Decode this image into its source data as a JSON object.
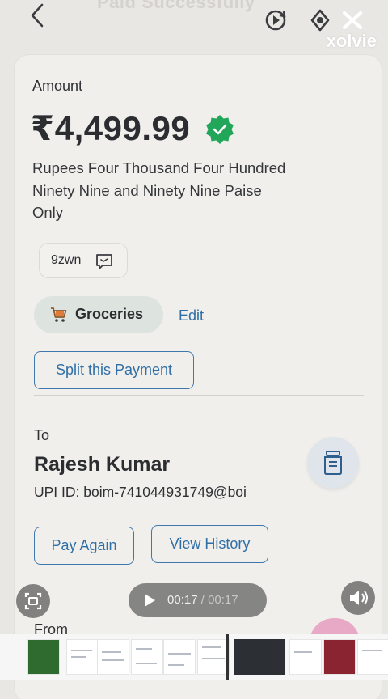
{
  "header": {
    "faded_title": "Paid Successfully",
    "brand": "xolvie",
    "icons": [
      "back-arrow-icon",
      "replay-icon",
      "rotate-icon",
      "xolvie-logo-icon"
    ]
  },
  "amount": {
    "label": "Amount",
    "value": "₹4,499.99",
    "words": "Rupees Four Thousand Four Hundred Ninety Nine and Ninety Nine Paise Only",
    "verified_color": "#22a65a"
  },
  "note": {
    "text": "9zwn"
  },
  "category": {
    "label": "Groceries",
    "edit": "Edit"
  },
  "actions": {
    "split": "Split this Payment",
    "pay_again": "Pay Again",
    "view_history": "View History"
  },
  "payee": {
    "to_label": "To",
    "name": "Rajesh Kumar",
    "upi": "UPI ID: boim-741044931749@boi"
  },
  "from": {
    "label": "From"
  },
  "player": {
    "current": "00:17",
    "separator": "/",
    "total": "00:17"
  },
  "colors": {
    "accent": "#2f6fa6",
    "card": "#f1efec",
    "chip": "#dde3df"
  }
}
